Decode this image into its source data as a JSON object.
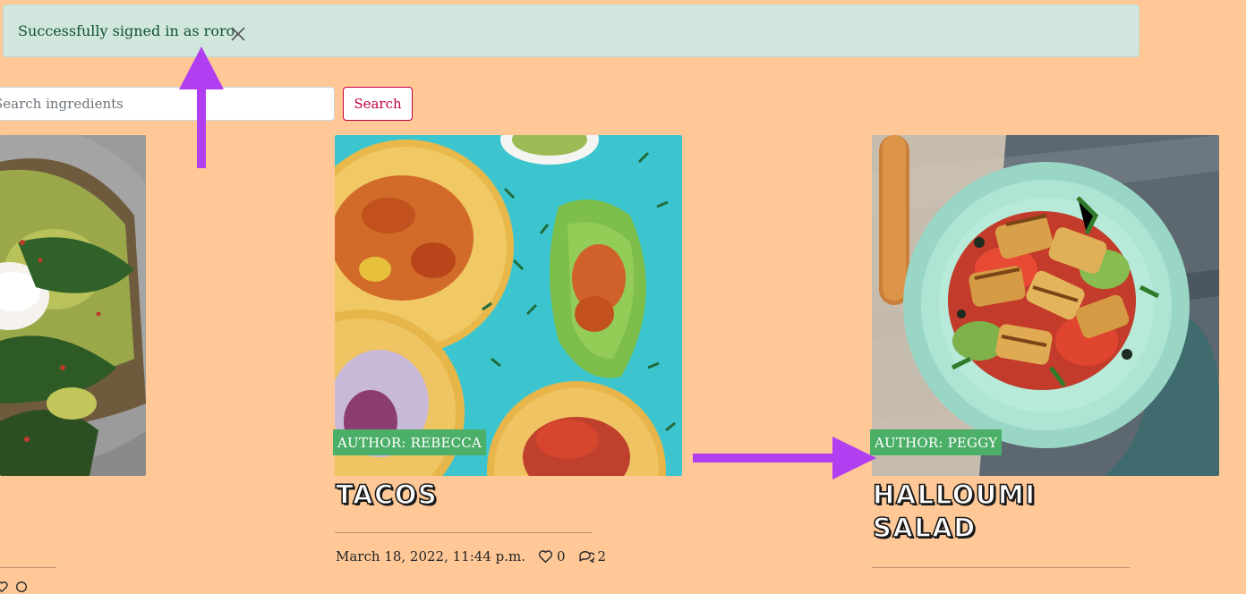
{
  "alert": {
    "message": "Successfully signed in as roro.",
    "close_icon": "close-icon"
  },
  "search": {
    "placeholder": "Search ingredients",
    "button_label": "Search"
  },
  "recipes": [
    {
      "image": "avocado-toast-photo",
      "author": "",
      "title": "",
      "date": "",
      "likes": "",
      "comments": ""
    },
    {
      "image": "tacos-photo",
      "author": "AUTHOR: REBECCA",
      "title": "TACOS",
      "date": "March 18, 2022, 11:44 p.m.",
      "likes": "0",
      "comments": "2"
    },
    {
      "image": "halloumi-salad-photo",
      "author": "AUTHOR: PEGGY",
      "title_line1": "HALLOUMI",
      "title_line2": "SALAD",
      "date": "",
      "likes": "",
      "comments": ""
    }
  ],
  "colors": {
    "page_background": "#ffc896",
    "alert_background": "#d1e7dd",
    "alert_text": "#0f5132",
    "search_button": "#c8003c",
    "author_badge": "#4caf68",
    "annotation_arrow": "#b13ef0"
  },
  "icons": {
    "like": "heart-icon",
    "comment": "comments-icon",
    "annotation": "arrow-annotation"
  }
}
